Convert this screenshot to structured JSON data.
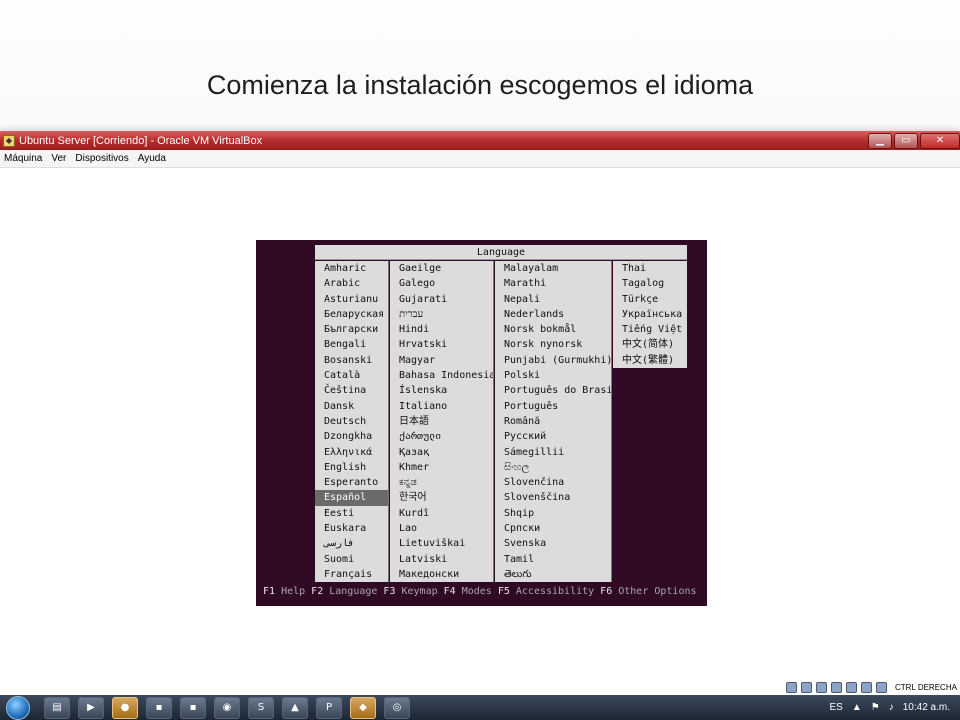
{
  "slide_title": "Comienza la instalación escogemos el idioma",
  "window": {
    "title": "Ubuntu Server [Corriendo] - Oracle VM VirtualBox",
    "menu": [
      "Máquina",
      "Ver",
      "Dispositivos",
      "Ayuda"
    ]
  },
  "dialog": {
    "header": "Language",
    "selected": "Español",
    "columns": [
      [
        "Amharic",
        "Arabic",
        "Asturianu",
        "Беларуская",
        "Български",
        "Bengali",
        "Bosanski",
        "Català",
        "Čeština",
        "Dansk",
        "Deutsch",
        "Dzongkha",
        "Ελληνικά",
        "English",
        "Esperanto",
        "Español",
        "Eesti",
        "Euskara",
        "فارسی",
        "Suomi",
        "Français"
      ],
      [
        "Gaeilge",
        "Galego",
        "Gujarati",
        "עברית",
        "Hindi",
        "Hrvatski",
        "Magyar",
        "Bahasa Indonesia",
        "Íslenska",
        "Italiano",
        "日本語",
        "ქართული",
        "Қазақ",
        "Khmer",
        "ಕನ್ನಡ",
        "한국어",
        "Kurdî",
        "Lao",
        "Lietuviškai",
        "Latviski",
        "Македонски"
      ],
      [
        "Malayalam",
        "Marathi",
        "Nepali",
        "Nederlands",
        "Norsk bokmål",
        "Norsk nynorsk",
        "Punjabi (Gurmukhi)",
        "Polski",
        "Português do Brasil",
        "Português",
        "Română",
        "Русский",
        "Sámegillii",
        "සිංහල",
        "Slovenčina",
        "Slovenščina",
        "Shqip",
        "Српски",
        "Svenska",
        "Tamil",
        "తెలుగు"
      ],
      [
        "Thai",
        "Tagalog",
        "Türkçe",
        "Українська",
        "Tiếng Việt",
        "中文(简体)",
        "中文(繁體)"
      ]
    ]
  },
  "function_keys": [
    {
      "key": "F1",
      "label": "Help"
    },
    {
      "key": "F2",
      "label": "Language"
    },
    {
      "key": "F3",
      "label": "Keymap"
    },
    {
      "key": "F4",
      "label": "Modes"
    },
    {
      "key": "F5",
      "label": "Accessibility"
    },
    {
      "key": "F6",
      "label": "Other Options"
    }
  ],
  "vm_status": {
    "host_key": "CTRL DERECHA"
  },
  "taskbar": {
    "language": "ES",
    "time": "10:42 a.m."
  },
  "colors": {
    "console_bg": "#300a24",
    "dialog_bg": "#dcdcdc",
    "selection": "#6a6a6a",
    "titlebar": "#b12a2a"
  }
}
